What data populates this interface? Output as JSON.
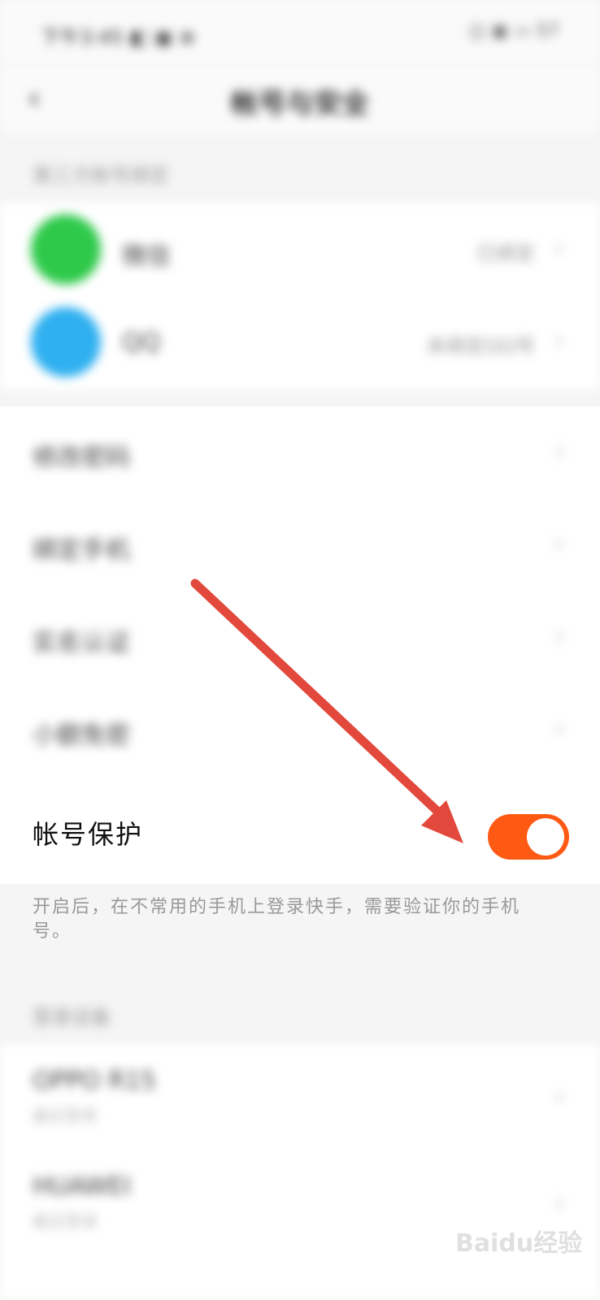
{
  "status_bar": {
    "time": "下午3:45 ◧ ▣ ⊕",
    "right": "◫ ▣ ▭ 57"
  },
  "nav": {
    "back_icon": "chevron-left-icon",
    "title": "帐号与安全"
  },
  "sections": {
    "third_party_label": "第三方帐号绑定",
    "wechat_label": "微信",
    "wechat_value": "已绑定",
    "qq_label": "QQ",
    "qq_value": "未绑定QQ号",
    "settings": [
      "修改密码",
      "绑定手机",
      "实名认证",
      "小额免密"
    ],
    "protect_label": "帐号保护",
    "protect_enabled": true,
    "protect_desc": "开启后，在不常用的手机上登录快手，需要验证你的手机号。",
    "devices_label": "登录设备",
    "devices": [
      {
        "name": "OPPO R15",
        "sub": "最近登录"
      },
      {
        "name": "HUAWEI",
        "sub": "最近登录"
      }
    ]
  },
  "watermark": "Baidu经验",
  "colors": {
    "accent": "#ff5a14",
    "wechat": "#2ec94a",
    "qq": "#2fb0f0",
    "arrow": "#e2483b"
  }
}
